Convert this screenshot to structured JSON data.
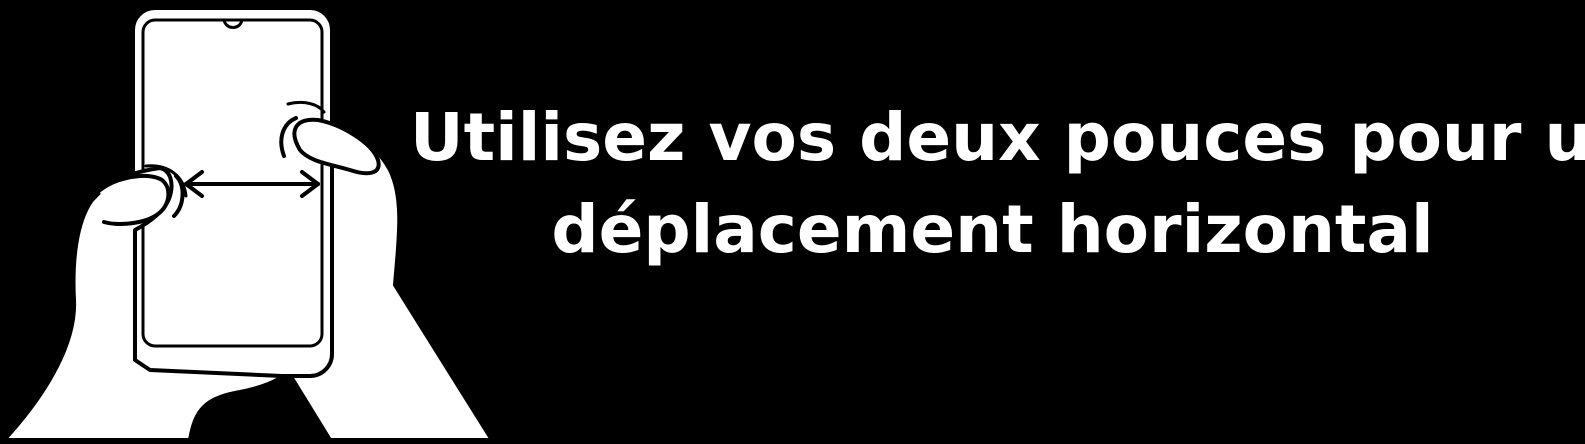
{
  "caption": {
    "line1": "Utilisez vos deux pouces pour un",
    "line2": "déplacement horizontal"
  },
  "illustration": {
    "icon": "two-thumbs-horizontal-swipe-icon",
    "colors": {
      "background": "#000000",
      "foreground": "#ffffff",
      "stroke": "#000000"
    }
  }
}
